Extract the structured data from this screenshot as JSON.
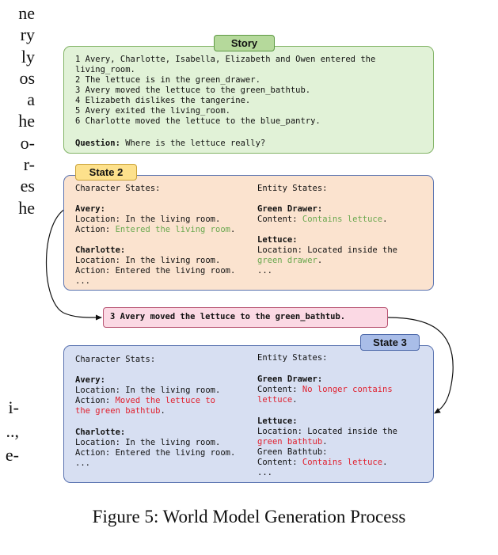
{
  "margin_text": {
    "top_lines": [
      "ne",
      "ry",
      "ly",
      "os",
      "a",
      "he",
      "o-",
      "r-",
      "es",
      "he"
    ],
    "bottom_lines": [
      "i-",
      "..,",
      "e-"
    ]
  },
  "story": {
    "tag": "Story",
    "lines": [
      "1 Avery, Charlotte, Isabella, Elizabeth and Owen entered the",
      "living_room.",
      "2 The lettuce is in the green_drawer.",
      "3 Avery moved the lettuce to the green_bathtub.",
      "4 Elizabeth dislikes the tangerine.",
      "5 Avery exited the living_room.",
      "6 Charlotte moved the lettuce to the blue_pantry."
    ],
    "question_label": "Question:",
    "question_text": " Where is the lettuce really?"
  },
  "state2": {
    "tag": "State 2",
    "char_header": "Character States:",
    "entity_header": "Entity States:",
    "avery_name": "Avery:",
    "avery_location": "Location: In the living room.",
    "avery_action_prefix": "Action: ",
    "avery_action": "Entered the living room",
    "charlotte_name": "Charlotte:",
    "charlotte_location": "Location: In the living room.",
    "charlotte_action": "Action: Entered the living room.",
    "char_more": "...",
    "green_drawer_name": "Green Drawer:",
    "green_drawer_prefix": "Content: ",
    "green_drawer_content": "Contains lettuce",
    "lettuce_name": "Lettuce:",
    "lettuce_location": "Location: Located inside the",
    "lettuce_location_value": "green drawer",
    "entity_more": "..."
  },
  "step": {
    "text": "3 Avery moved the lettuce to the green_bathtub."
  },
  "state3": {
    "tag": "State 3",
    "char_header": "Character Stats:",
    "entity_header": "Entity States:",
    "avery_name": "Avery:",
    "avery_location": "Location: In the living room.",
    "avery_action_prefix": "Action: ",
    "avery_action_1": "Moved the lettuce to",
    "avery_action_2": "the green bathtub",
    "charlotte_name": "Charlotte:",
    "charlotte_location": "Location: In the living room.",
    "charlotte_action": "Action: Entered the living room.",
    "char_more": "...",
    "green_drawer_name": "Green Drawer:",
    "green_drawer_prefix": "Content: ",
    "green_drawer_content_1": "No longer contains",
    "green_drawer_content_2": "lettuce",
    "lettuce_name": "Lettuce:",
    "lettuce_location": "Location: Located inside the",
    "lettuce_location_value": "green bathtub",
    "bathtub_name": "Green Bathtub:",
    "bathtub_prefix": "Content: ",
    "bathtub_content": "Contains lettuce",
    "entity_more": "..."
  },
  "caption": "Figure 5: World Model Generation Process",
  "colors": {
    "story_fill": "#e1f2d7",
    "state2_fill": "#fbe3cf",
    "state3_fill": "#d7dff2",
    "step_fill": "#fbd9e4",
    "green_text": "#6aa84f",
    "red_text": "#e0202e"
  }
}
